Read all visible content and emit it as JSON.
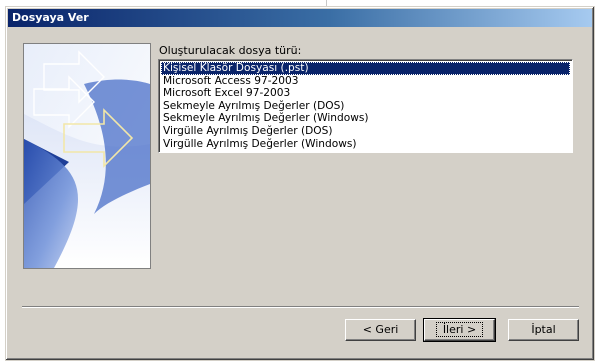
{
  "window": {
    "title": "Dosyaya Ver"
  },
  "main": {
    "list_label": "Oluşturulacak dosya türü:",
    "file_types": [
      "Kişisel Klasör Dosyası (.pst)",
      "Microsoft Access 97-2003",
      "Microsoft Excel 97-2003",
      "Sekmeyle Ayrılmış Değerler (DOS)",
      "Sekmeyle Ayrılmış Değerler (Windows)",
      "Virgülle Ayrılmış Değerler (DOS)",
      "Virgülle Ayrılmış Değerler (Windows)"
    ],
    "selected_index": 0
  },
  "buttons": {
    "back": "< Geri",
    "next": "İleri >",
    "cancel": "İptal"
  },
  "colors": {
    "selection": "#0a246a",
    "dialog_bg": "#d4d0c8",
    "title_gradient_start": "#0a246a",
    "title_gradient_end": "#a6caf0"
  },
  "icons": {
    "wizard_graphic": "import-export-arrows-graphic"
  }
}
